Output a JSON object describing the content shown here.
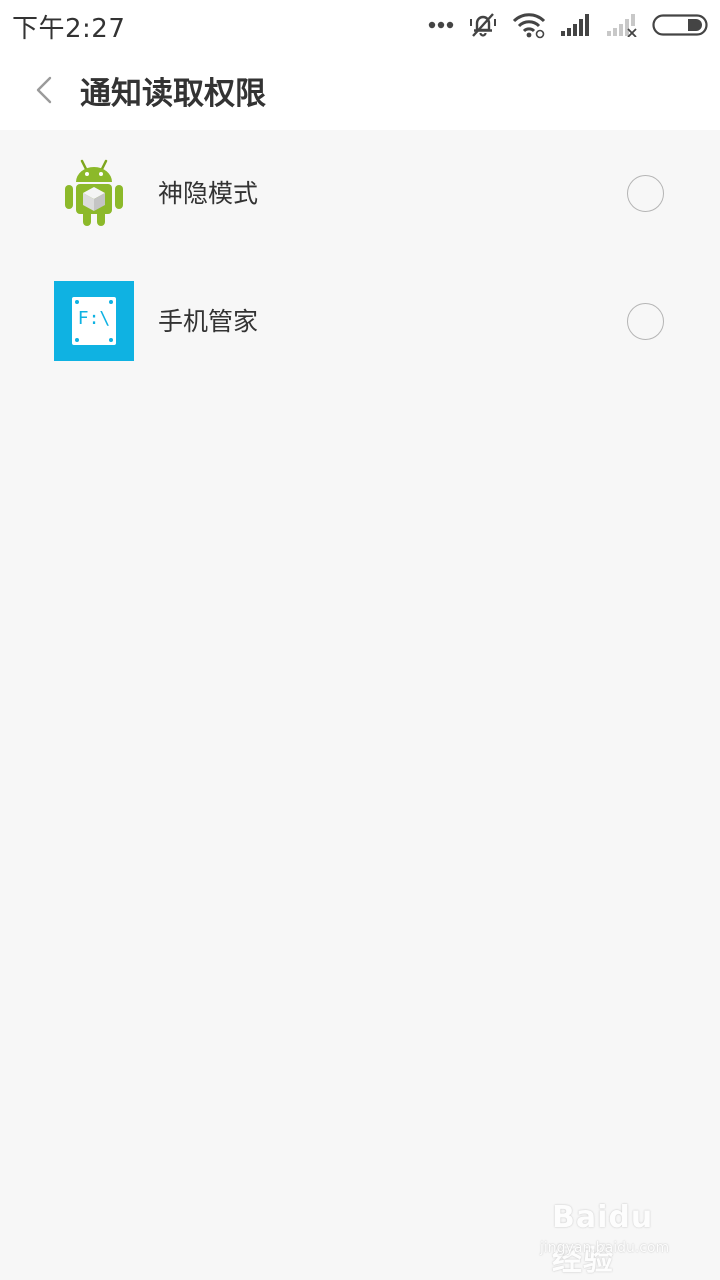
{
  "status_bar": {
    "time": "下午2:27",
    "icons": [
      "more-dots-icon",
      "mute-bell-icon",
      "wifi-icon",
      "signal-icon",
      "signal-no-sim-icon",
      "battery-icon"
    ]
  },
  "header": {
    "title": "通知读取权限",
    "back_icon": "chevron-left-icon"
  },
  "apps": [
    {
      "name": "神隐模式",
      "icon": "android-box-icon",
      "selected": false
    },
    {
      "name": "手机管家",
      "icon": "file-manager-icon",
      "icon_text": "F:\\",
      "selected": false
    }
  ],
  "watermark": {
    "logo": "Baidu经验",
    "url": "jingyan.baidu.com"
  },
  "colors": {
    "background": "#f7f7f7",
    "header_bg": "#ffffff",
    "text": "#333333",
    "radio_border": "#b5b5b5",
    "file_manager_blue": "#0fb2e2",
    "android_green": "#8cb92a"
  }
}
